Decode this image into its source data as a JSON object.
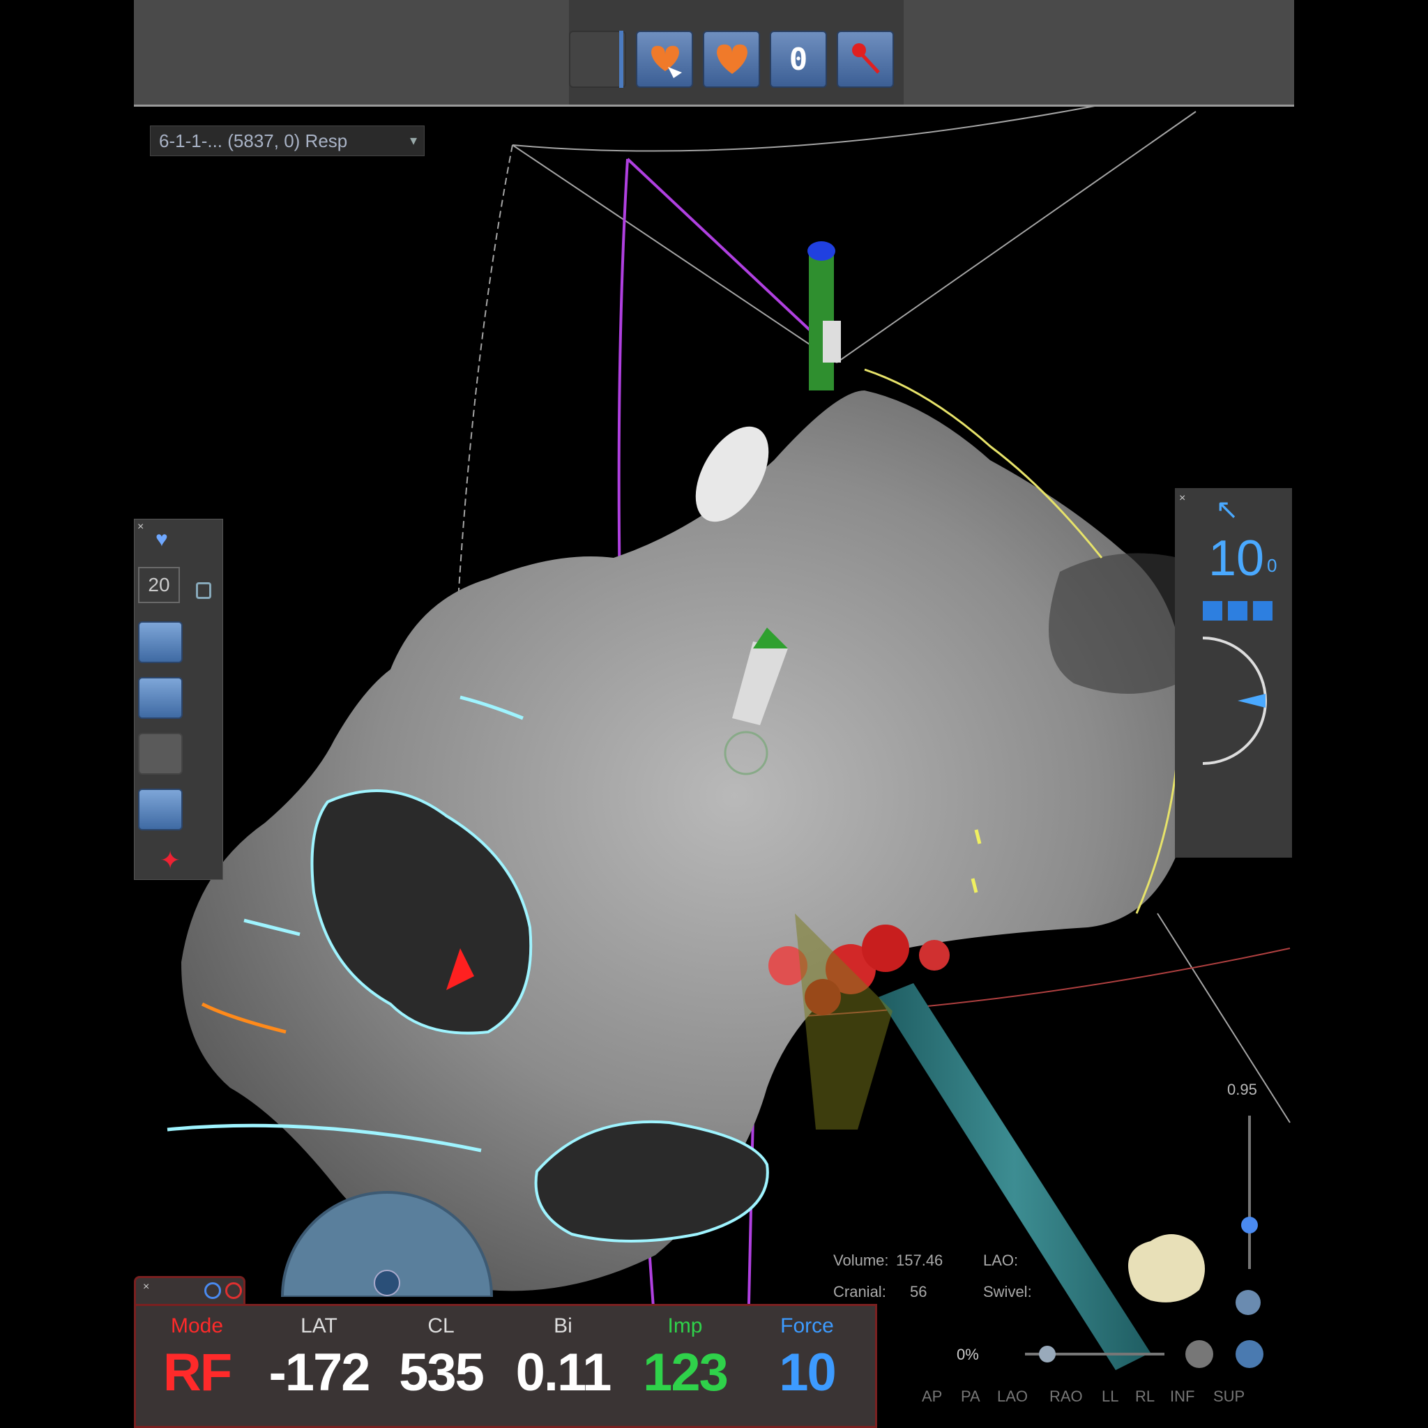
{
  "colors": {
    "mode": "#ff2a2a",
    "lat": "#ffffff",
    "cl": "#ffffff",
    "bi": "#ffffff",
    "imp": "#2fd24a",
    "force": "#3d9bff",
    "mesh": "#8a8a8a",
    "contour": "#9ff4ff",
    "catheter": "#2a7a80"
  },
  "toolbar": {
    "icons": [
      "record-icon",
      "heart-export-icon",
      "heart-shell-icon",
      "zero-icon",
      "pin-icon"
    ],
    "zero_label": "0"
  },
  "dataset": {
    "label": "6-1-1-... (5837, 0) Resp"
  },
  "left_panel": {
    "number": "20",
    "icons": [
      "filter-heart-icon",
      "lock-icon",
      "layers-icon",
      "heart-arrow-icon",
      "disabled-tool-icon",
      "heart-map-icon",
      "clear-icon"
    ]
  },
  "right_panel": {
    "value": "10",
    "sub": "0",
    "icons": [
      "cursor-arrow-icon",
      "view-square-icon",
      "view-square-icon",
      "view-square-icon",
      "compass-dial-icon"
    ]
  },
  "info": {
    "mode": {
      "label": "Mode",
      "value": "RF"
    },
    "lat": {
      "label": "LAT",
      "value": "-172"
    },
    "cl": {
      "label": "CL",
      "value": "535"
    },
    "bi": {
      "label": "Bi",
      "value": "0.11"
    },
    "imp": {
      "label": "Imp",
      "value": "123"
    },
    "force": {
      "label": "Force",
      "value": "10"
    }
  },
  "view_info": {
    "volume_label": "Volume:",
    "volume_value": "157.46",
    "cranial_label": "Cranial:",
    "cranial_value": "56",
    "lao_label": "LAO:",
    "swivel_label": "Swivel:",
    "transparency_top": "0.95",
    "opacity_label": "0%"
  },
  "views": [
    "AP",
    "PA",
    "LAO",
    "RAO",
    "LL",
    "RL",
    "INF",
    "SUP"
  ]
}
